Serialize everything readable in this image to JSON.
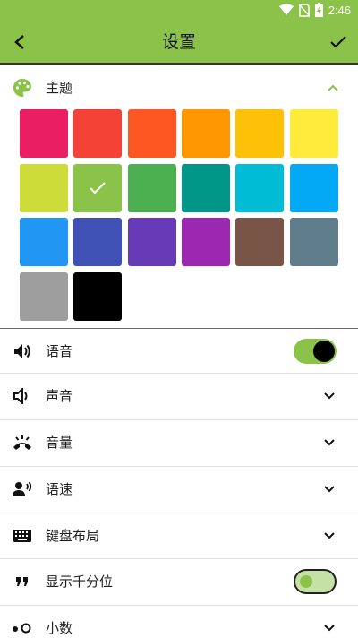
{
  "status_bar": {
    "time": "2:46",
    "icons": [
      "wifi-icon",
      "no-sim-icon",
      "battery-charging-icon"
    ]
  },
  "app_bar": {
    "title": "设置",
    "back_icon": "back-arrow-icon",
    "done_icon": "check-icon"
  },
  "theme_section": {
    "label": "主题",
    "icon": "palette-icon",
    "expanded": true,
    "selected_index": 7,
    "colors": [
      "#e91e63",
      "#f44336",
      "#ff5722",
      "#ff9800",
      "#ffc107",
      "#ffeb3b",
      "#cddc39",
      "#8bc34a",
      "#4caf50",
      "#009688",
      "#00bcd4",
      "#03a9f4",
      "#2196f3",
      "#3f51b5",
      "#673ab7",
      "#9c27b0",
      "#795548",
      "#607d8b",
      "#9e9e9e",
      "#000000"
    ]
  },
  "settings": [
    {
      "label": "语音",
      "icon": "speaker-icon",
      "control": "toggle",
      "on": true
    },
    {
      "label": "声音",
      "icon": "sound-icon",
      "control": "chevron"
    },
    {
      "label": "音量",
      "icon": "volume-ringer-icon",
      "control": "chevron"
    },
    {
      "label": "语速",
      "icon": "voice-speed-icon",
      "control": "chevron"
    },
    {
      "label": "键盘布局",
      "icon": "keyboard-icon",
      "control": "chevron"
    },
    {
      "label": "显示千分位",
      "icon": "quote-icon",
      "control": "toggle",
      "on": false
    },
    {
      "label": "小数",
      "icon": "decimal-icon",
      "control": "chevron"
    }
  ],
  "colors": {
    "accent": "#8bc34a",
    "divider": "#e2e2e2"
  }
}
